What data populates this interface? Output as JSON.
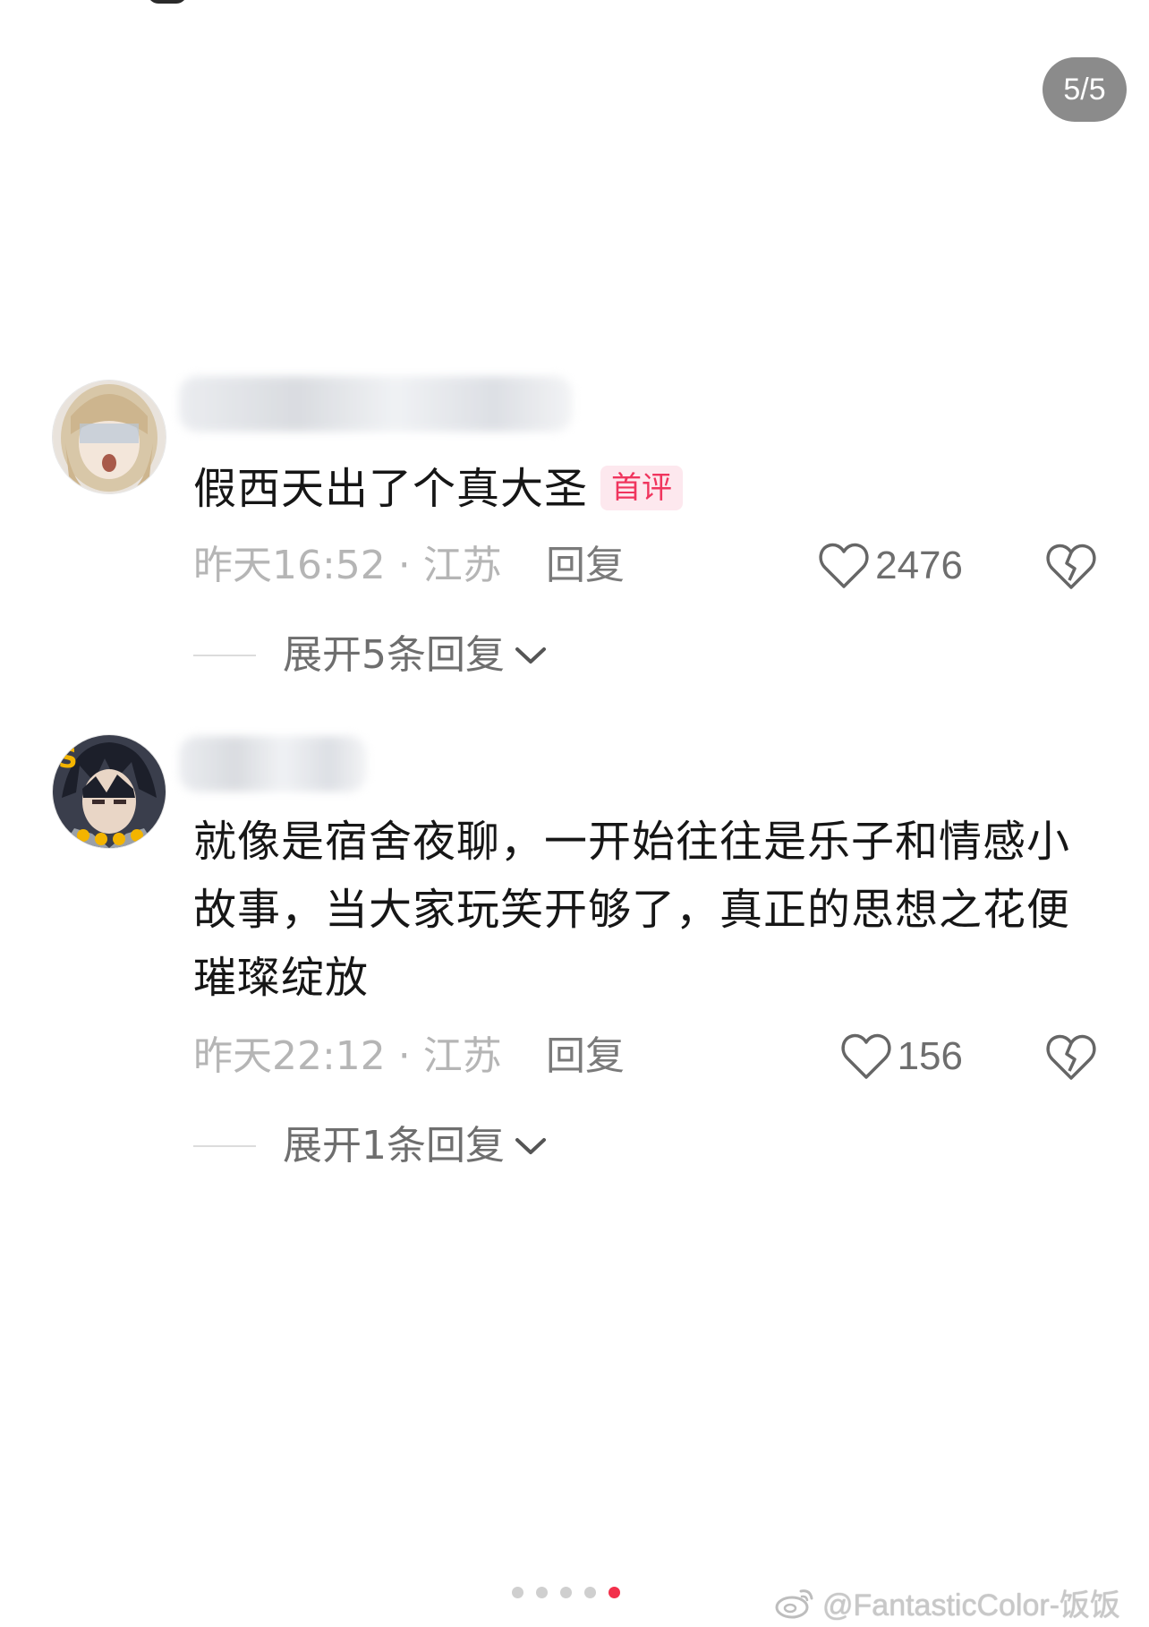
{
  "page_counter": "5/5",
  "comments": [
    {
      "text": "假西天出了个真大圣",
      "badge": "首评",
      "time_location": "昨天16:52 · 江苏",
      "reply_label": "回复",
      "like_count": "2476",
      "expand_label": "展开5条回复"
    },
    {
      "text": "就像是宿舍夜聊，一开始往往是乐子和情感小故事，当大家玩笑开够了，真正的思想之花便璀璨绽放",
      "badge": "",
      "time_location": "昨天22:12 · 江苏",
      "reply_label": "回复",
      "like_count": "156",
      "expand_label": "展开1条回复"
    }
  ],
  "pager": {
    "total": 5,
    "active_index": 5
  },
  "watermark": "@FantasticColor-饭饭",
  "colors": {
    "badge_text": "#f0355e",
    "badge_bg": "#fde8ee",
    "pager_active": "#f2304b",
    "meta_gray": "#b5b5b5"
  },
  "icons": [
    "heart-outline-icon",
    "broken-heart-icon",
    "chevron-down-icon",
    "weibo-icon"
  ]
}
